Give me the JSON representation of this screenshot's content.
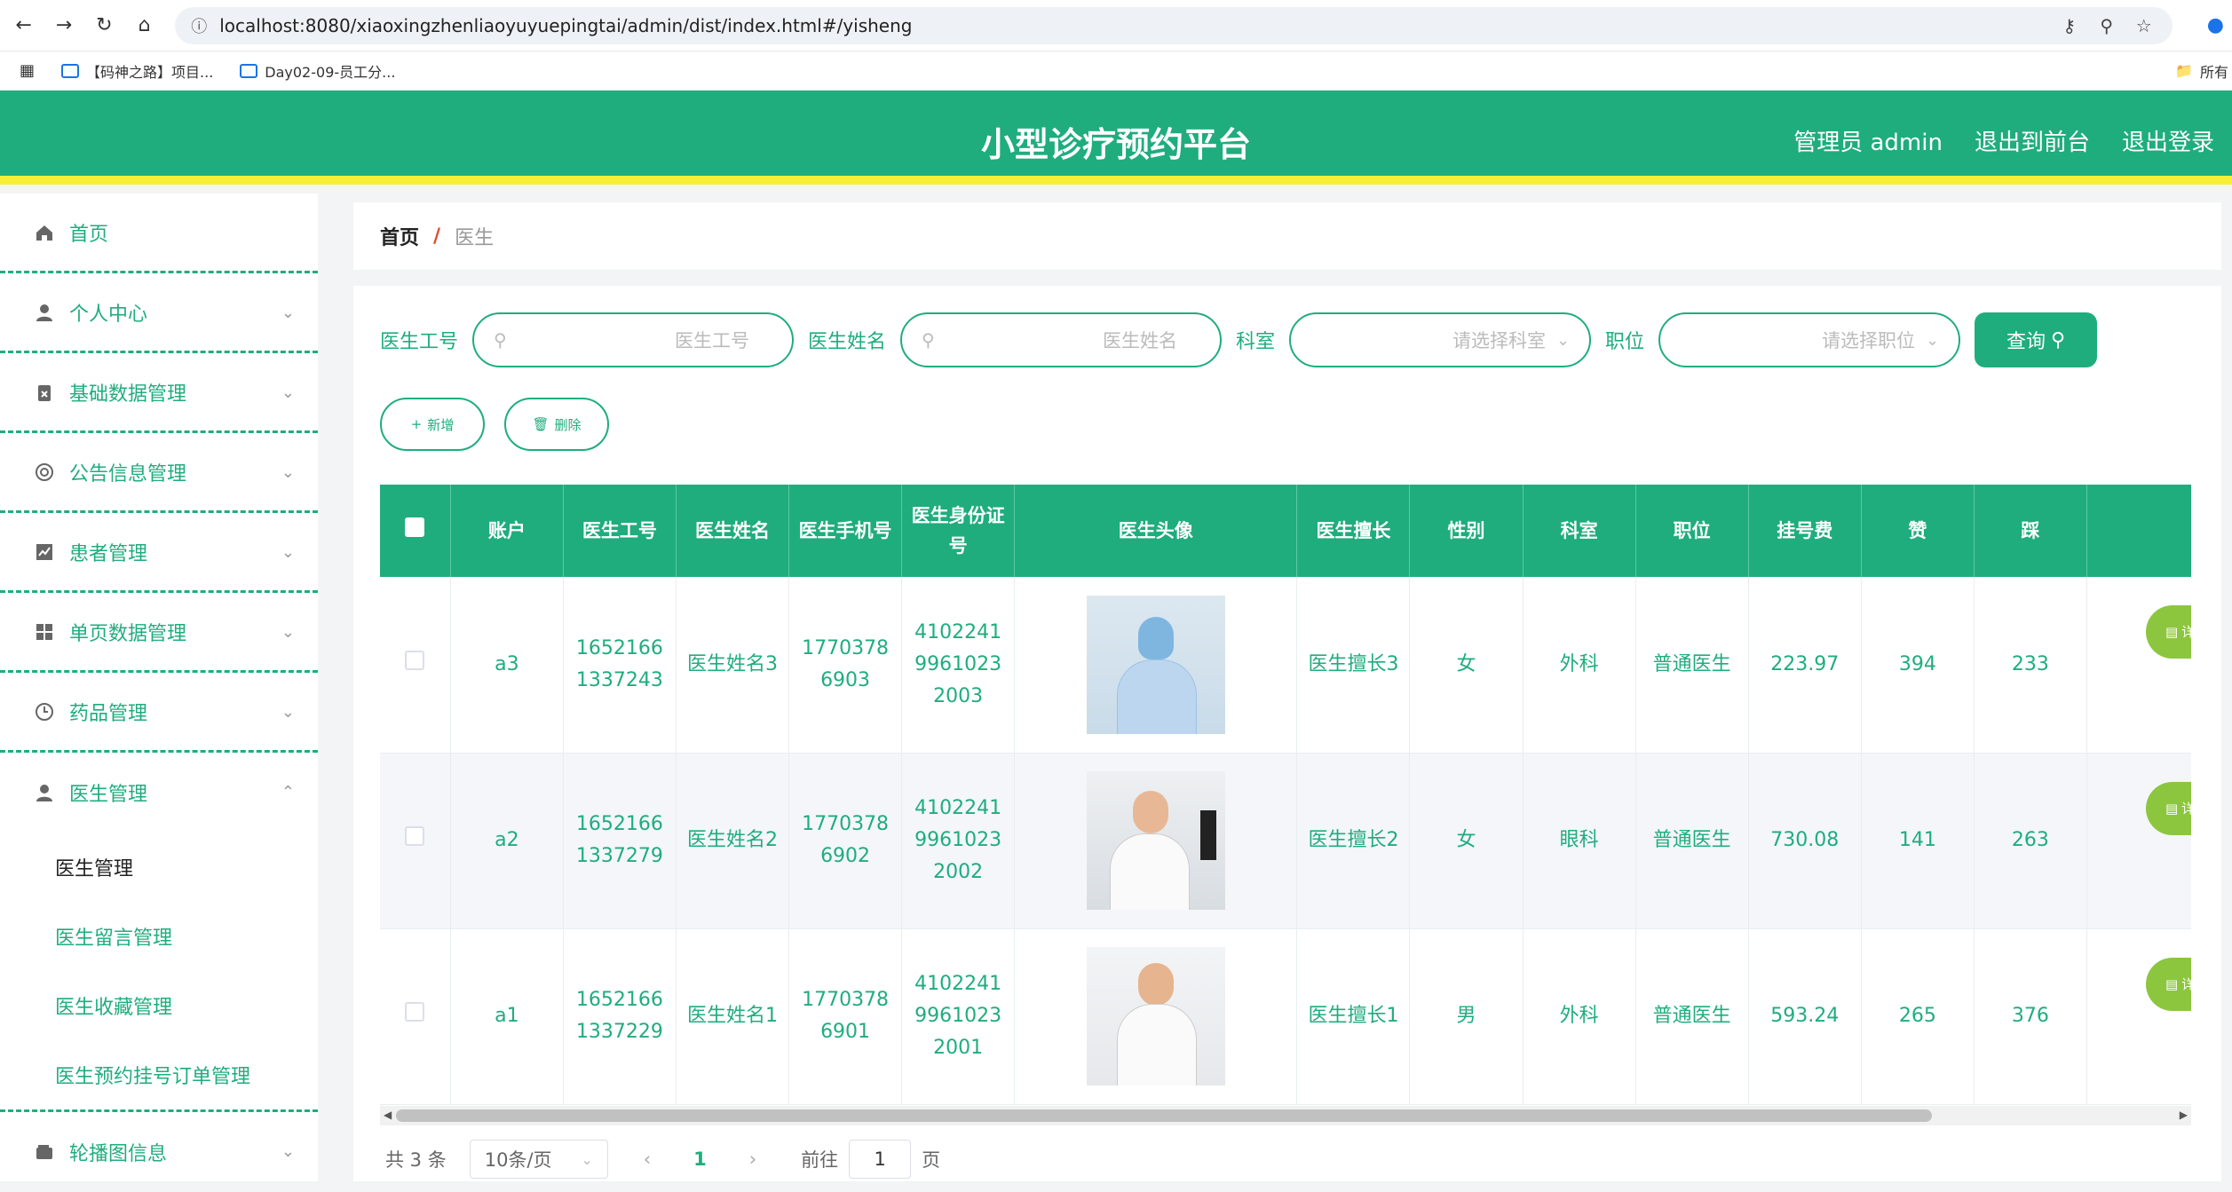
{
  "browser": {
    "url": "localhost:8080/xiaoxingzhenliaoyuyuepingtai/admin/dist/index.html#/yisheng",
    "bookmarks": [
      "【码神之路】项目...",
      "Day02-09-员工分..."
    ],
    "bookmarks_right": "所有"
  },
  "header": {
    "title": "小型诊疗预约平台",
    "admin": "管理员 admin",
    "to_front": "退出到前台",
    "logout": "退出登录"
  },
  "sidebar": {
    "items": [
      {
        "label": "首页"
      },
      {
        "label": "个人中心"
      },
      {
        "label": "基础数据管理"
      },
      {
        "label": "公告信息管理"
      },
      {
        "label": "患者管理"
      },
      {
        "label": "单页数据管理"
      },
      {
        "label": "药品管理"
      },
      {
        "label": "医生管理"
      }
    ],
    "sub_items": [
      "医生管理",
      "医生留言管理",
      "医生收藏管理",
      "医生预约挂号订单管理"
    ],
    "last_item": {
      "label": "轮播图信息"
    }
  },
  "breadcrumb": {
    "home": "首页",
    "sep": "/",
    "current": "医生"
  },
  "search": {
    "label_id": "医生工号",
    "ph_id": "医生工号",
    "label_name": "医生姓名",
    "ph_name": "医生姓名",
    "label_dept": "科室",
    "ph_dept": "请选择科室",
    "label_pos": "职位",
    "ph_pos": "请选择职位",
    "query": "查询"
  },
  "actions": {
    "add": "新增",
    "delete": "删除"
  },
  "table": {
    "headers": [
      "账户",
      "医生工号",
      "医生姓名",
      "医生手机号",
      "医生身份证号",
      "医生头像",
      "医生擅长",
      "性别",
      "科室",
      "职位",
      "挂号费",
      "赞",
      "踩"
    ],
    "rows": [
      {
        "account": "a3",
        "id": "16521661337243",
        "name": "医生姓名3",
        "phone": "17703786903",
        "idcard": "410224199610232003",
        "skill": "医生擅长3",
        "gender": "女",
        "dept": "外科",
        "pos": "普通医生",
        "fee": "223.97",
        "like": "394",
        "dislike": "233",
        "detail": "详情"
      },
      {
        "account": "a2",
        "id": "16521661337279",
        "name": "医生姓名2",
        "phone": "17703786902",
        "idcard": "410224199610232002",
        "skill": "医生擅长2",
        "gender": "女",
        "dept": "眼科",
        "pos": "普通医生",
        "fee": "730.08",
        "like": "141",
        "dislike": "263",
        "detail": "详情"
      },
      {
        "account": "a1",
        "id": "16521661337229",
        "name": "医生姓名1",
        "phone": "17703786901",
        "idcard": "410224199610232001",
        "skill": "医生擅长1",
        "gender": "男",
        "dept": "外科",
        "pos": "普通医生",
        "fee": "593.24",
        "like": "265",
        "dislike": "376",
        "detail": "详情"
      }
    ]
  },
  "pager": {
    "total": "共 3 条",
    "size": "10条/页",
    "current": "1",
    "goto": "前往",
    "goto_val": "1",
    "page": "页"
  },
  "colors": {
    "primary": "#1fad7d",
    "accent": "#f7ee35",
    "detail": "#8cc63e"
  }
}
